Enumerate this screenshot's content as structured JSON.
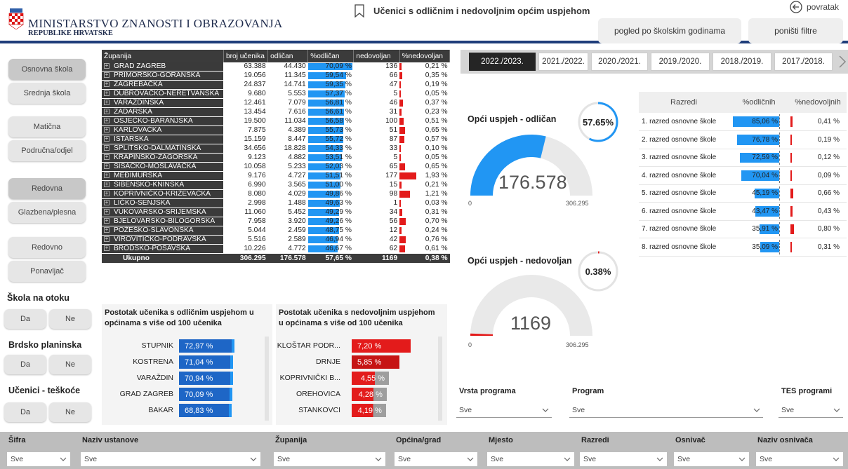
{
  "header": {
    "ministry_line1": "MINISTARSTVO ZNANOSTI I OBRAZOVANJA",
    "ministry_line2": "REPUBLIKE HRVATSKE",
    "report_title": "Učenici s odličnim i nedovoljnim općim uspjehom",
    "back_label": "povratak",
    "btn_year_view": "pogled po školskim godinama",
    "btn_reset": "poništi filtre"
  },
  "slicers": {
    "school_type": [
      "Osnovna škola",
      "Srednja škola"
    ],
    "school_kind": [
      "Matična",
      "Područna/odjel"
    ],
    "program_kind": [
      "Redovna",
      "Glazbena/plesna"
    ],
    "status": [
      "Redovno",
      "Ponavljač"
    ],
    "island": {
      "title": "Škola na otoku",
      "options": [
        "Da",
        "Ne"
      ]
    },
    "mountain": {
      "title": "Brdsko planinska",
      "options": [
        "Da",
        "Ne"
      ]
    },
    "difficulties": {
      "title": "Učenici - teškoće",
      "options": [
        "Da",
        "Ne"
      ]
    }
  },
  "province_table": {
    "headers": [
      "Županija",
      "broj učenika",
      "odličan",
      "%odličan",
      "nedovoljan",
      "%nedovoljan"
    ],
    "rows": [
      {
        "name": "GRAD ZAGREB",
        "students": "63.388",
        "excellent": "44.430",
        "pct_excellent": "70,09 %",
        "exc_val": 70.09,
        "insufficient": "136",
        "pct_insufficient": "0,21 %",
        "ins_val": 0.21
      },
      {
        "name": "PRIMORSKO-GORANSKA",
        "students": "19.056",
        "excellent": "11.345",
        "pct_excellent": "59,54 %",
        "exc_val": 59.54,
        "insufficient": "66",
        "pct_insufficient": "0,35 %",
        "ins_val": 0.35
      },
      {
        "name": "ZAGREBAČKA",
        "students": "24.837",
        "excellent": "14.741",
        "pct_excellent": "59,35 %",
        "exc_val": 59.35,
        "insufficient": "47",
        "pct_insufficient": "0,19 %",
        "ins_val": 0.19
      },
      {
        "name": "DUBROVAČKO-NERETVANSKA",
        "students": "9.680",
        "excellent": "5.553",
        "pct_excellent": "57,37 %",
        "exc_val": 57.37,
        "insufficient": "5",
        "pct_insufficient": "0,05 %",
        "ins_val": 0.05
      },
      {
        "name": "VARAŽDINSKA",
        "students": "12.461",
        "excellent": "7.079",
        "pct_excellent": "56,81 %",
        "exc_val": 56.81,
        "insufficient": "46",
        "pct_insufficient": "0,37 %",
        "ins_val": 0.37
      },
      {
        "name": "ZADARSKA",
        "students": "13.454",
        "excellent": "7.616",
        "pct_excellent": "56,61 %",
        "exc_val": 56.61,
        "insufficient": "31",
        "pct_insufficient": "0,23 %",
        "ins_val": 0.23
      },
      {
        "name": "OSJEČKO-BARANJSKA",
        "students": "19.500",
        "excellent": "11.034",
        "pct_excellent": "56,58 %",
        "exc_val": 56.58,
        "insufficient": "100",
        "pct_insufficient": "0,51 %",
        "ins_val": 0.51
      },
      {
        "name": "KARLOVAČKA",
        "students": "7.875",
        "excellent": "4.389",
        "pct_excellent": "55,73 %",
        "exc_val": 55.73,
        "insufficient": "51",
        "pct_insufficient": "0,65 %",
        "ins_val": 0.65
      },
      {
        "name": "ISTARSKA",
        "students": "15.159",
        "excellent": "8.447",
        "pct_excellent": "55,72 %",
        "exc_val": 55.72,
        "insufficient": "87",
        "pct_insufficient": "0,57 %",
        "ins_val": 0.57
      },
      {
        "name": "SPLITSKO-DALMATINSKA",
        "students": "34.656",
        "excellent": "18.828",
        "pct_excellent": "54,33 %",
        "exc_val": 54.33,
        "insufficient": "33",
        "pct_insufficient": "0,10 %",
        "ins_val": 0.1
      },
      {
        "name": "KRAPINSKO-ZAGORSKA",
        "students": "9.123",
        "excellent": "4.882",
        "pct_excellent": "53,51 %",
        "exc_val": 53.51,
        "insufficient": "5",
        "pct_insufficient": "0,05 %",
        "ins_val": 0.05
      },
      {
        "name": "SISAČKO-MOSLAVAČKA",
        "students": "10.058",
        "excellent": "5.233",
        "pct_excellent": "52,03 %",
        "exc_val": 52.03,
        "insufficient": "65",
        "pct_insufficient": "0,65 %",
        "ins_val": 0.65
      },
      {
        "name": "MEĐIMURSKA",
        "students": "9.176",
        "excellent": "4.727",
        "pct_excellent": "51,51 %",
        "exc_val": 51.51,
        "insufficient": "177",
        "pct_insufficient": "1,93 %",
        "ins_val": 1.93
      },
      {
        "name": "ŠIBENSKO-KNINSKA",
        "students": "6.990",
        "excellent": "3.565",
        "pct_excellent": "51,00 %",
        "exc_val": 51.0,
        "insufficient": "15",
        "pct_insufficient": "0,21 %",
        "ins_val": 0.21
      },
      {
        "name": "KOPRIVNIČKO-KRIŽEVAČKA",
        "students": "8.080",
        "excellent": "4.029",
        "pct_excellent": "49,86 %",
        "exc_val": 49.86,
        "insufficient": "98",
        "pct_insufficient": "1,21 %",
        "ins_val": 1.21
      },
      {
        "name": "LIČKO-SENJSKA",
        "students": "2.998",
        "excellent": "1.488",
        "pct_excellent": "49,63 %",
        "exc_val": 49.63,
        "insufficient": "1",
        "pct_insufficient": "0,03 %",
        "ins_val": 0.03
      },
      {
        "name": "VUKOVARSKO-SRIJEMSKA",
        "students": "11.060",
        "excellent": "5.452",
        "pct_excellent": "49,29 %",
        "exc_val": 49.29,
        "insufficient": "34",
        "pct_insufficient": "0,31 %",
        "ins_val": 0.31
      },
      {
        "name": "BJELOVARSKO-BILOGORSKA",
        "students": "7.958",
        "excellent": "3.920",
        "pct_excellent": "49,26 %",
        "exc_val": 49.26,
        "insufficient": "56",
        "pct_insufficient": "0,70 %",
        "ins_val": 0.7
      },
      {
        "name": "POŽEŠKO-SLAVONSKA",
        "students": "5.044",
        "excellent": "2.459",
        "pct_excellent": "48,75 %",
        "exc_val": 48.75,
        "insufficient": "12",
        "pct_insufficient": "0,24 %",
        "ins_val": 0.24
      },
      {
        "name": "VIROVITIČKO-PODRAVSKA",
        "students": "5.516",
        "excellent": "2.589",
        "pct_excellent": "46,94 %",
        "exc_val": 46.94,
        "insufficient": "42",
        "pct_insufficient": "0,76 %",
        "ins_val": 0.76
      },
      {
        "name": "BRODSKO-POSAVSKA",
        "students": "10.226",
        "excellent": "4.772",
        "pct_excellent": "46,67 %",
        "exc_val": 46.67,
        "insufficient": "62",
        "pct_insufficient": "0,61 %",
        "ins_val": 0.61
      }
    ],
    "total": {
      "name": "Ukupno",
      "students": "306.295",
      "excellent": "176.578",
      "pct_excellent": "57,65 %",
      "insufficient": "1169",
      "pct_insufficient": "0,38 %"
    }
  },
  "excellent_card": {
    "title_line1": "Postotak učenika s odličnim uspjehom u",
    "title_line2": "općinama s više od 100 učenika",
    "rows": [
      {
        "label": "STUPNIK",
        "value": "72,97 %",
        "val": 72.97
      },
      {
        "label": "KOSTRENA",
        "value": "71,04 %",
        "val": 71.04
      },
      {
        "label": "VARAŽDIN",
        "value": "70,94 %",
        "val": 70.94
      },
      {
        "label": "GRAD ZAGREB",
        "value": "70,09 %",
        "val": 70.09
      },
      {
        "label": "BAKAR",
        "value": "68,83 %",
        "val": 68.83
      }
    ]
  },
  "insufficient_card": {
    "title_line1": "Postotak učenika s nedovoljnim uspjehom",
    "title_line2": "u općinama s više od 100 učenika",
    "rows": [
      {
        "label": "KLOŠTAR PODR...",
        "value": "7,20 %",
        "val": 7.2
      },
      {
        "label": "DRNJE",
        "value": "5,85 %",
        "val": 5.85
      },
      {
        "label": "KOPRIVNIČKI B...",
        "value": "4,55 %",
        "val": 4.55
      },
      {
        "label": "OREHOVICA",
        "value": "4,28 %",
        "val": 4.28
      },
      {
        "label": "STANKOVCI",
        "value": "4,19 %",
        "val": 4.19
      }
    ]
  },
  "year_tabs": [
    "2022./2023.",
    "2021./2022.",
    "2020./2021.",
    "2019./2020.",
    "2018./2019.",
    "2017./2018."
  ],
  "gauge_excellent": {
    "title": "Opći uspjeh - odličan",
    "ring_label": "57.65%",
    "ring_val": 57.65,
    "value": "176.578",
    "min": "0",
    "max": "306.295",
    "fraction": 0.5765
  },
  "gauge_insufficient": {
    "title": "Opći uspjeh - nedovoljan",
    "ring_label": "0.38%",
    "ring_val": 0.38,
    "value": "1169",
    "min": "0",
    "max": "306.295",
    "fraction": 0.0038
  },
  "class_table": {
    "headers": [
      "Razredi",
      "%odličnih",
      "%nedovoljnih"
    ],
    "rows": [
      {
        "label": "1. razred osnovne škole",
        "pct_exc": "85,06 %",
        "exc_val": 85.06,
        "pct_ins": "0,41 %",
        "ins_val": 0.41
      },
      {
        "label": "2. razred osnovne škole",
        "pct_exc": "76,78 %",
        "exc_val": 76.78,
        "pct_ins": "0,19 %",
        "ins_val": 0.19
      },
      {
        "label": "3. razred osnovne škole",
        "pct_exc": "72,59 %",
        "exc_val": 72.59,
        "pct_ins": "0,12 %",
        "ins_val": 0.12
      },
      {
        "label": "4. razred osnovne škole",
        "pct_exc": "70,04 %",
        "exc_val": 70.04,
        "pct_ins": "0,09 %",
        "ins_val": 0.09
      },
      {
        "label": "5. razred osnovne škole",
        "pct_exc": "45,19 %",
        "exc_val": 45.19,
        "pct_ins": "0,66 %",
        "ins_val": 0.66
      },
      {
        "label": "6. razred osnovne škole",
        "pct_exc": "43,47 %",
        "exc_val": 43.47,
        "pct_ins": "0,43 %",
        "ins_val": 0.43
      },
      {
        "label": "7. razred osnovne škole",
        "pct_exc": "35,91 %",
        "exc_val": 35.91,
        "pct_ins": "0,80 %",
        "ins_val": 0.8
      },
      {
        "label": "8. razred osnovne škole",
        "pct_exc": "35,09 %",
        "exc_val": 35.09,
        "pct_ins": "0,31 %",
        "ins_val": 0.31
      }
    ]
  },
  "filters": {
    "program_type": {
      "label": "Vrsta programa",
      "value": "Sve"
    },
    "program": {
      "label": "Program",
      "value": "Sve"
    },
    "tes": {
      "label": "TES programi",
      "value": "Sve"
    }
  },
  "bottom_filters": [
    {
      "label": "Šifra",
      "value": "Sve"
    },
    {
      "label": "Naziv ustanove",
      "value": "Sve"
    },
    {
      "label": "Županija",
      "value": "Sve"
    },
    {
      "label": "Općina/grad",
      "value": "Sve"
    },
    {
      "label": "Mjesto",
      "value": "Sve"
    },
    {
      "label": "Razredi",
      "value": "Sve"
    },
    {
      "label": "Osnivač",
      "value": "Sve"
    },
    {
      "label": "Naziv osnivača",
      "value": "Sve"
    }
  ],
  "colors": {
    "blue": "#2196f3",
    "red": "#e31b1b",
    "dark": "#3b3b3b",
    "navy": "#1f3d7a"
  }
}
